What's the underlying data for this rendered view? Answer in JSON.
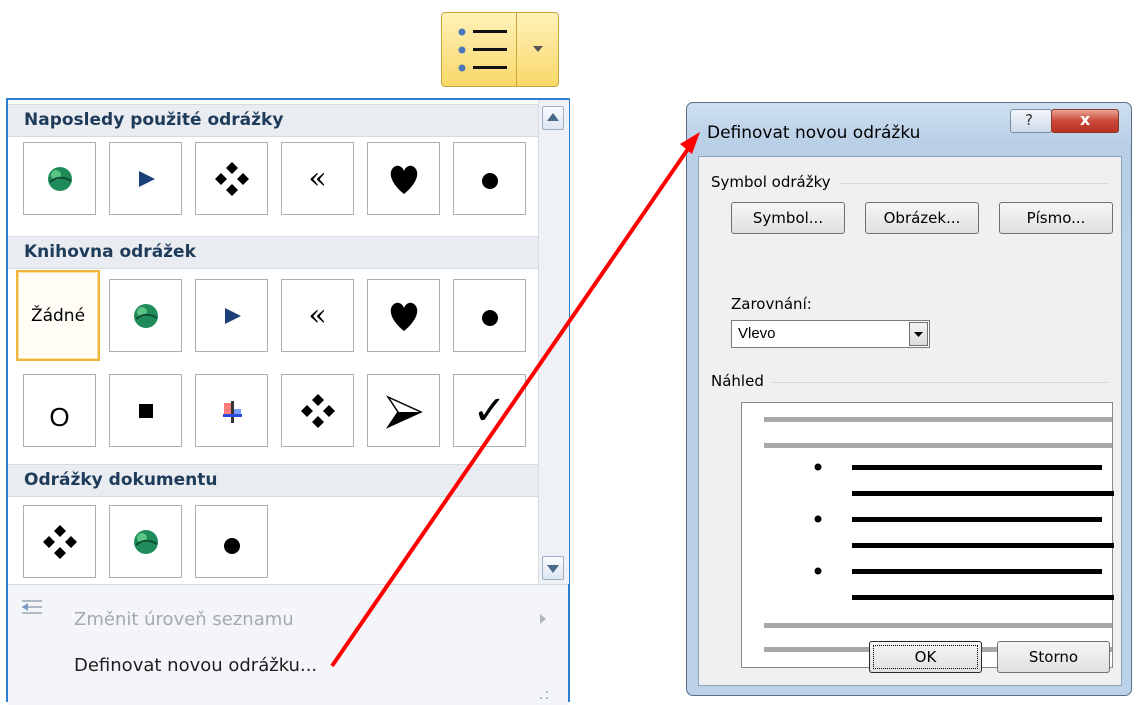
{
  "gallery": {
    "section_recent": "Naposledy použité odrážky",
    "section_library": "Knihovna odrážek",
    "section_document": "Odrážky dokumentu",
    "none_label": "Žádné",
    "recent_bullets": [
      "globe-bullet",
      "arrow-bullet",
      "diamond-dots-bullet",
      "guillemet-bullet",
      "heart-bullet",
      "dot-bullet"
    ],
    "library_row1": [
      "none",
      "globe-bullet",
      "arrow-bullet",
      "guillemet-bullet",
      "heart-bullet",
      "dot-bullet"
    ],
    "library_row2": [
      "circle-bullet",
      "square-bullet",
      "cross-picture-bullet",
      "diamond-dots-bullet",
      "arrowhead-bullet",
      "checkmark-bullet"
    ],
    "document_bullets": [
      "diamond-dots-bullet",
      "globe-bullet",
      "dot-bullet"
    ],
    "guillemet_glyph": "«",
    "check_glyph": "✓",
    "circle_glyph": "O",
    "menu_change_level": "Změnit úroveň seznamu",
    "menu_define_new": "Definovat novou odrážku..."
  },
  "dialog": {
    "title": "Definovat novou odrážku",
    "help_glyph": "?",
    "close_glyph": "x",
    "group_symbol": "Symbol odrážky",
    "btn_symbol": "Symbol...",
    "btn_picture": "Obrázek...",
    "btn_font": "Písmo...",
    "alignment_label": "Zarovnání:",
    "alignment_value": "Vlevo",
    "group_preview": "Náhled",
    "ok": "OK",
    "cancel": "Storno"
  },
  "colors": {
    "accent_border": "#2e7fd0",
    "ribbon_yellow": "#f9d86a",
    "arrow_red": "#ff0000",
    "bullet_navy": "#1d3f78",
    "globe_green": "#1f8a5a"
  }
}
